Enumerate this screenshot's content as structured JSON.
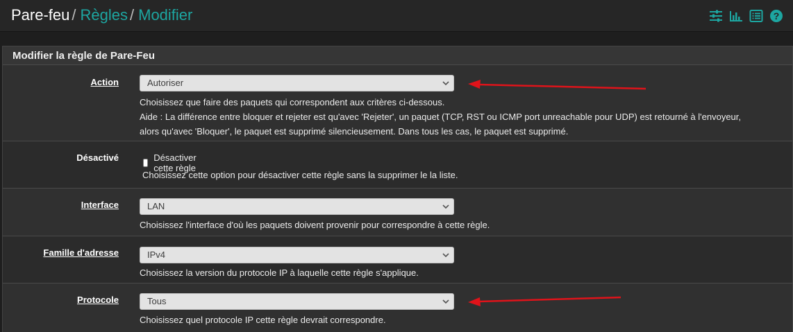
{
  "breadcrumb": {
    "root": "Pare-feu",
    "sep": "/",
    "level2": "Règles",
    "level3": "Modifier"
  },
  "toolbar_icons": [
    "sliders-icon",
    "bar-chart-icon",
    "list-icon",
    "help-icon"
  ],
  "panel": {
    "title": "Modifier la règle de Pare-Feu"
  },
  "action": {
    "label": "Action",
    "value": "Autoriser",
    "help1": "Choisissez que faire des paquets qui correspondent aux critères ci-dessous.",
    "help2": "Aide : La différence entre bloquer et rejeter est qu'avec 'Rejeter', un paquet (TCP, RST ou ICMP port unreachable pour UDP) est retourné à l'envoyeur,",
    "help3": "alors qu'avec 'Bloquer', le paquet est supprimé silencieusement. Dans tous les cas, le paquet est supprimé."
  },
  "disabled": {
    "label": "Désactivé",
    "checkbox_label": "Désactiver cette règle",
    "help": "Choisissez cette option pour désactiver cette règle sans la supprimer le la liste."
  },
  "interface": {
    "label": "Interface",
    "value": "LAN",
    "help": "Choisissez l'interface d'où les paquets doivent provenir pour correspondre à cette règle."
  },
  "address_family": {
    "label": "Famille d'adresse",
    "value": "IPv4",
    "help": "Choisissez la version du protocole IP à laquelle cette règle s'applique."
  },
  "protocol": {
    "label": "Protocole",
    "value": "Tous",
    "help": "Choisissez quel protocole IP cette règle devrait correspondre."
  },
  "colors": {
    "accent": "#1da6a1",
    "annotation_arrow": "#e0131a"
  }
}
